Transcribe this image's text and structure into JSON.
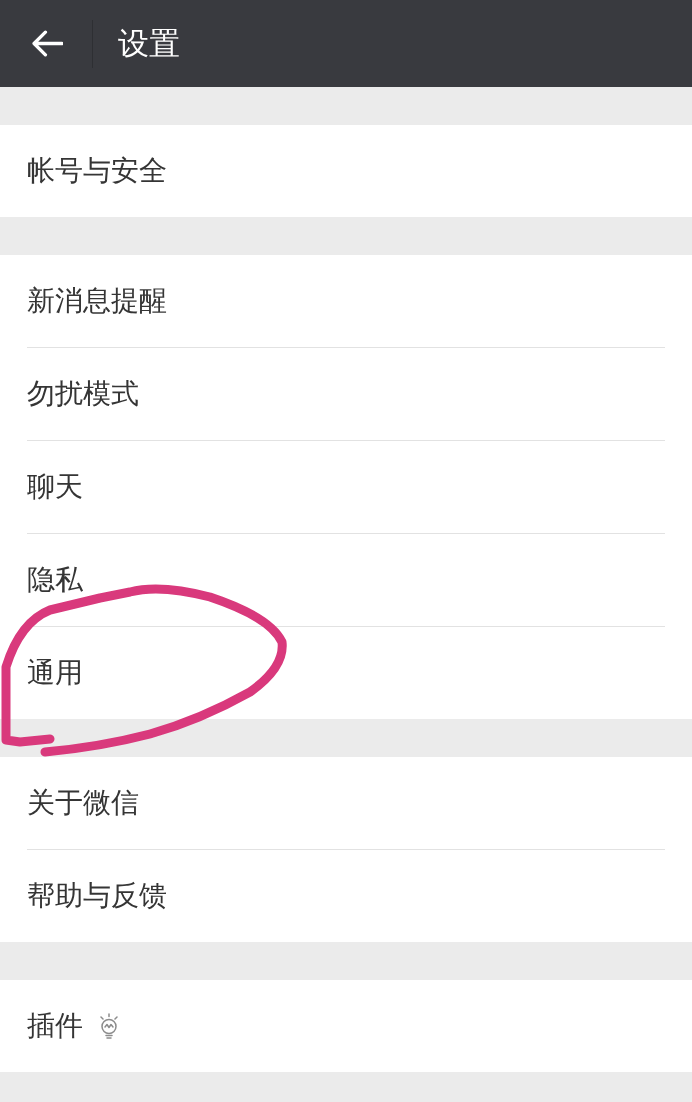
{
  "top_bar": {
    "title": "设置"
  },
  "groups": [
    {
      "items": [
        {
          "label": "帐号与安全",
          "kind": "plain",
          "circled": false
        }
      ]
    },
    {
      "items": [
        {
          "label": "新消息提醒",
          "kind": "plain",
          "circled": false
        },
        {
          "label": "勿扰模式",
          "kind": "plain",
          "circled": false
        },
        {
          "label": "聊天",
          "kind": "plain",
          "circled": false
        },
        {
          "label": "隐私",
          "kind": "plain",
          "circled": false
        },
        {
          "label": "通用",
          "kind": "plain",
          "circled": true
        }
      ]
    },
    {
      "items": [
        {
          "label": "关于微信",
          "kind": "plain",
          "circled": false
        },
        {
          "label": "帮助与反馈",
          "kind": "plain",
          "circled": false
        }
      ]
    },
    {
      "items": [
        {
          "label": "插件",
          "kind": "hint",
          "circled": false
        }
      ]
    }
  ]
}
